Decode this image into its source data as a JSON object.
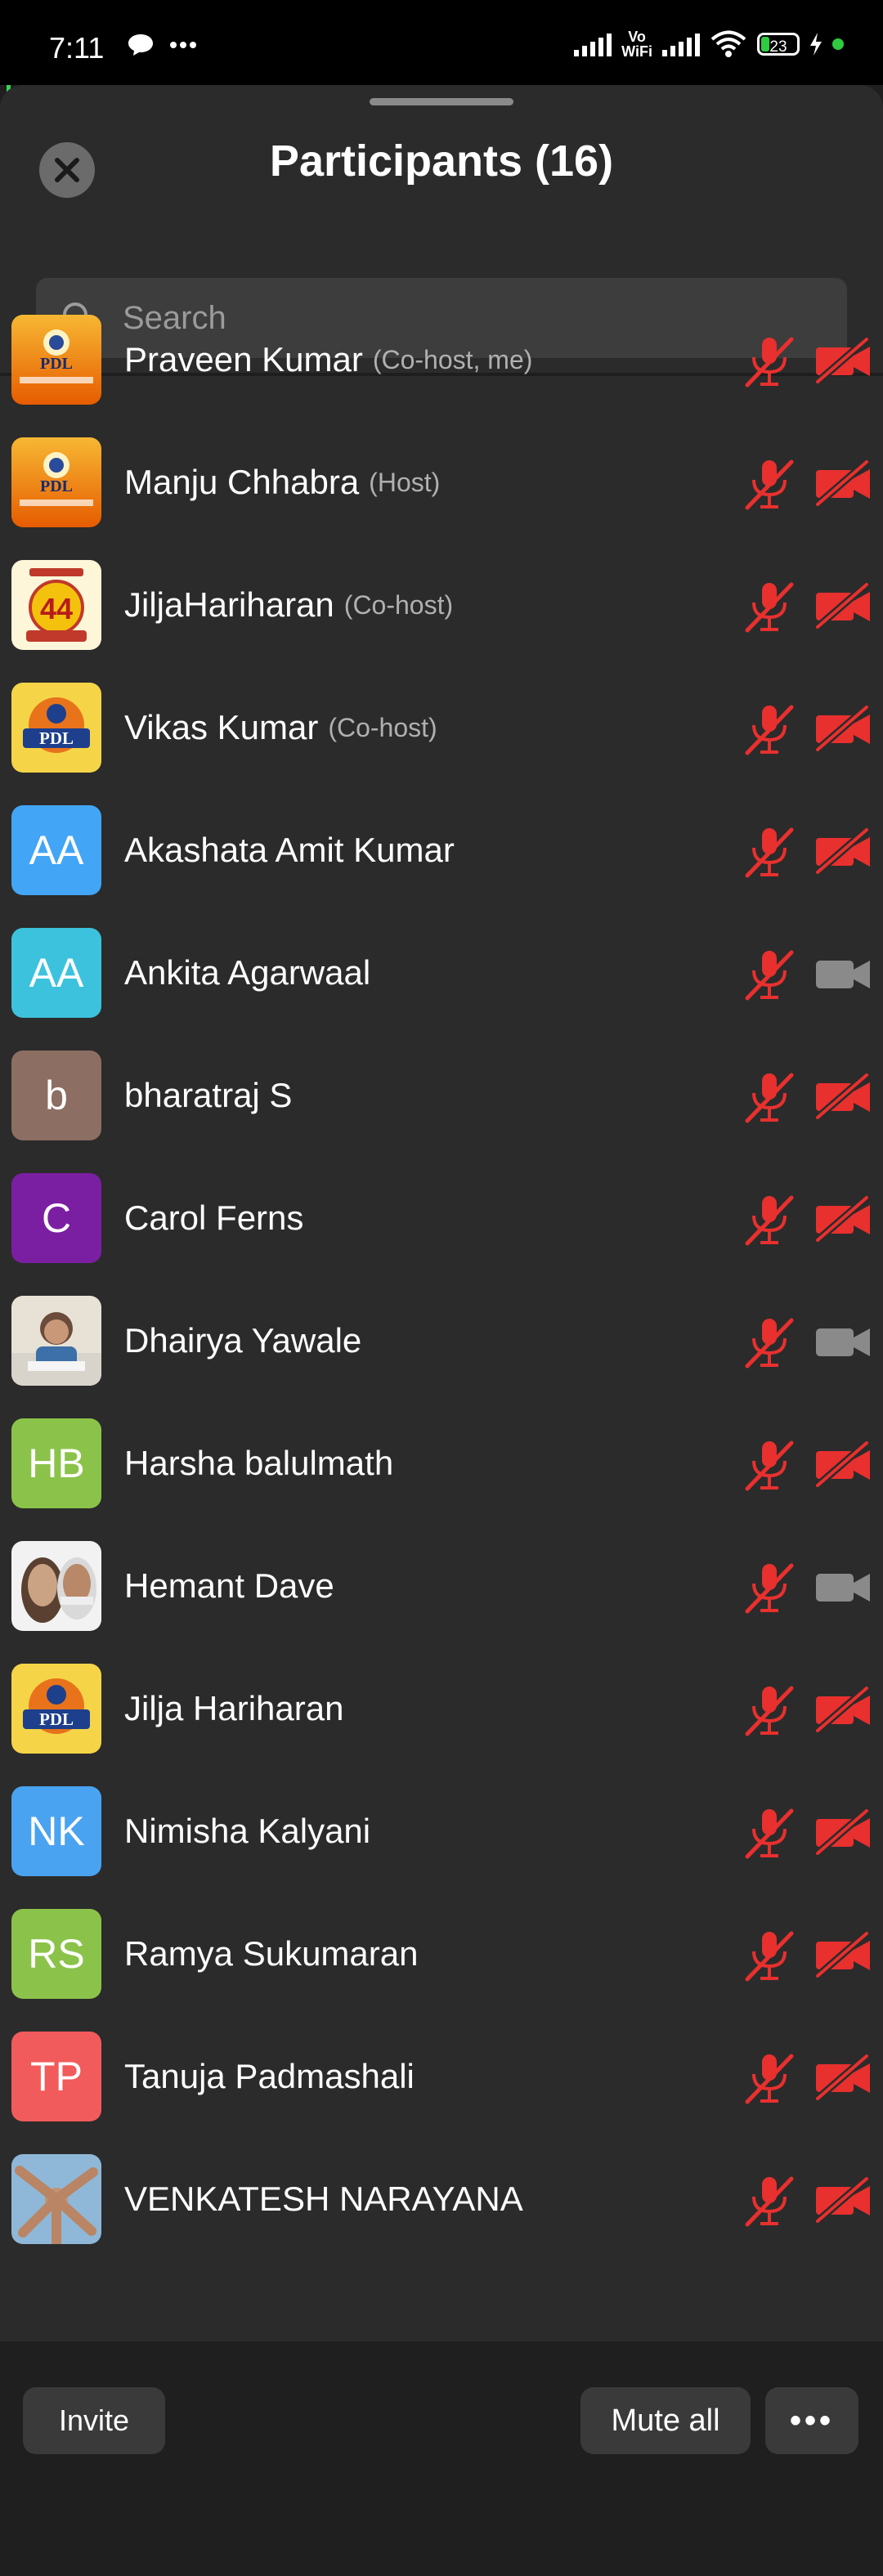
{
  "status_bar": {
    "time": "7:11",
    "left_icons": [
      "chat-bubble-icon",
      "more-dots-icon"
    ],
    "vo_wifi": "Vo\nWiFi",
    "battery": "23",
    "right_icons": [
      "signal-icon",
      "vowifi-icon",
      "signal-icon",
      "wifi-icon",
      "battery-icon",
      "charging-icon",
      "green-dot"
    ]
  },
  "header": {
    "title": "Participants (16)",
    "close_icon": "close-icon"
  },
  "search": {
    "placeholder": "Search"
  },
  "colors": {
    "muted_red": "#e8302e",
    "camera_gray": "#8a8a8a",
    "sheet_bg": "#2b2b2b"
  },
  "participants": [
    {
      "name": "Praveen Kumar",
      "role": "(Co-host, me)",
      "avatar": "PDL",
      "avatar_type": "logo-pdl",
      "video": "off"
    },
    {
      "name": "Manju Chhabra",
      "role": "(Host)",
      "avatar": "PDL",
      "avatar_type": "logo-pdl",
      "video": "off"
    },
    {
      "name": "JiljaHariharan",
      "role": "(Co-host)",
      "avatar": "44",
      "avatar_type": "logo-44",
      "video": "off"
    },
    {
      "name": "Vikas Kumar",
      "role": "(Co-host)",
      "avatar": "PDL",
      "avatar_type": "logo-pdl2",
      "video": "off"
    },
    {
      "name": "Akashata Amit Kumar",
      "role": "",
      "avatar": "AA",
      "avatar_type": "initials",
      "avatar_color": "#42a5f5",
      "video": "off"
    },
    {
      "name": "Ankita Agarwaal",
      "role": "",
      "avatar": "AA",
      "avatar_type": "initials",
      "avatar_color": "#3cc2dd",
      "video": "on"
    },
    {
      "name": "bharatraj S",
      "role": "",
      "avatar": "b",
      "avatar_type": "initials",
      "avatar_color": "#8d6e63",
      "video": "off"
    },
    {
      "name": "Carol Ferns",
      "role": "",
      "avatar": "C",
      "avatar_type": "initials",
      "avatar_color": "#7b1fa2",
      "video": "off"
    },
    {
      "name": "Dhairya Yawale",
      "role": "",
      "avatar": "",
      "avatar_type": "photo-child",
      "video": "on"
    },
    {
      "name": "Harsha balulmath",
      "role": "",
      "avatar": "HB",
      "avatar_type": "initials",
      "avatar_color": "#8bc34a",
      "video": "off"
    },
    {
      "name": "Hemant Dave",
      "role": "",
      "avatar": "",
      "avatar_type": "photo-men",
      "video": "on"
    },
    {
      "name": "Jilja Hariharan",
      "role": "",
      "avatar": "PDL",
      "avatar_type": "logo-pdl2",
      "video": "off"
    },
    {
      "name": "Nimisha Kalyani",
      "role": "",
      "avatar": "NK",
      "avatar_type": "initials",
      "avatar_color": "#4aa3f0",
      "video": "off"
    },
    {
      "name": "Ramya Sukumaran",
      "role": "",
      "avatar": "RS",
      "avatar_type": "initials",
      "avatar_color": "#8bc34a",
      "video": "off"
    },
    {
      "name": "Tanuja Padmashali",
      "role": "",
      "avatar": "TP",
      "avatar_type": "initials",
      "avatar_color": "#f25b5b",
      "video": "off"
    },
    {
      "name": "VENKATESH NARAYANA",
      "role": "",
      "avatar": "",
      "avatar_type": "photo-hands",
      "video": "off"
    }
  ],
  "footer": {
    "invite_label": "Invite",
    "mute_all_label": "Mute all",
    "more_label": "•••"
  }
}
